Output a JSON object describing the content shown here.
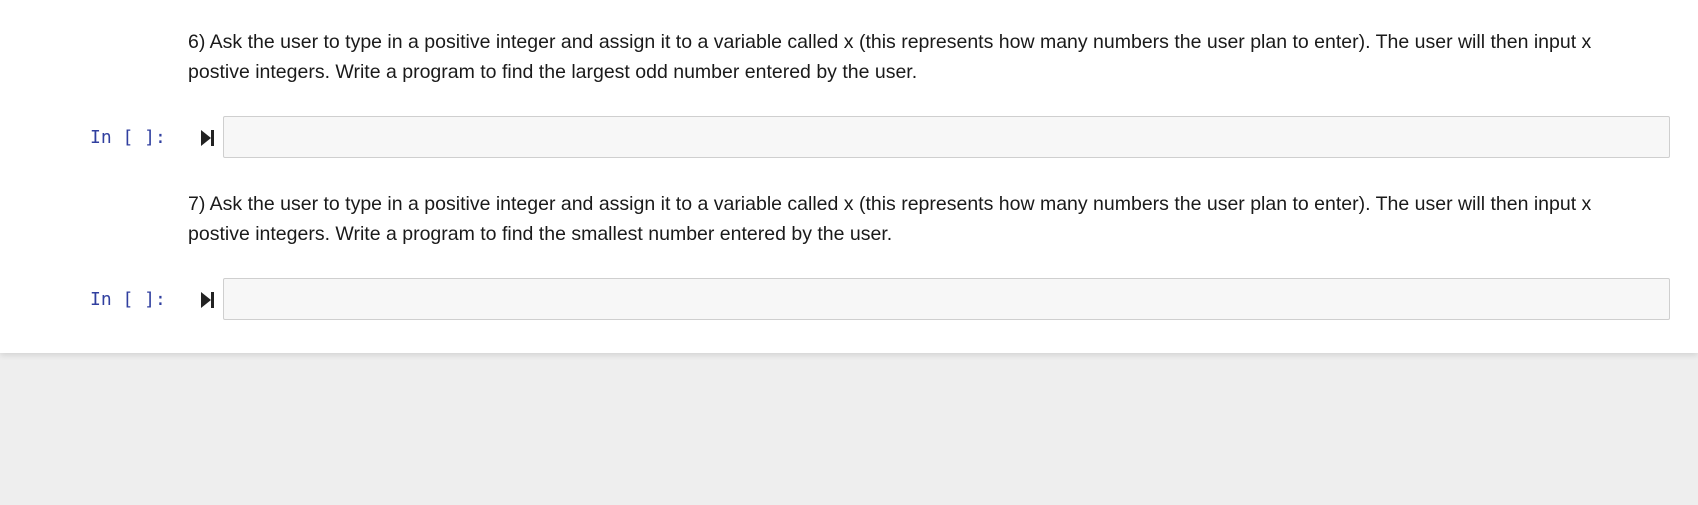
{
  "cells": [
    {
      "type": "markdown",
      "text": "6) Ask the user to type in a positive integer and assign it to a variable called x (this represents how many numbers the user plan to enter). The user will then input x postive integers. Write a program to find the largest odd number entered by the user."
    },
    {
      "type": "code",
      "prompt": "In [ ]:",
      "source": ""
    },
    {
      "type": "markdown",
      "text": "7) Ask the user to type in a positive integer and assign it to a variable called x (this represents how many numbers the user plan to enter). The user will then input x postive integers. Write a program to find the smallest number entered by the user."
    },
    {
      "type": "code",
      "prompt": "In [ ]:",
      "source": ""
    }
  ],
  "icons": {
    "run": "run-cell-icon"
  },
  "colors": {
    "prompt": "#303f9f",
    "input_bg": "#f7f7f7",
    "input_border": "#cfcfcf",
    "page_bg": "#ffffff",
    "outer_bg": "#eeeeee"
  }
}
